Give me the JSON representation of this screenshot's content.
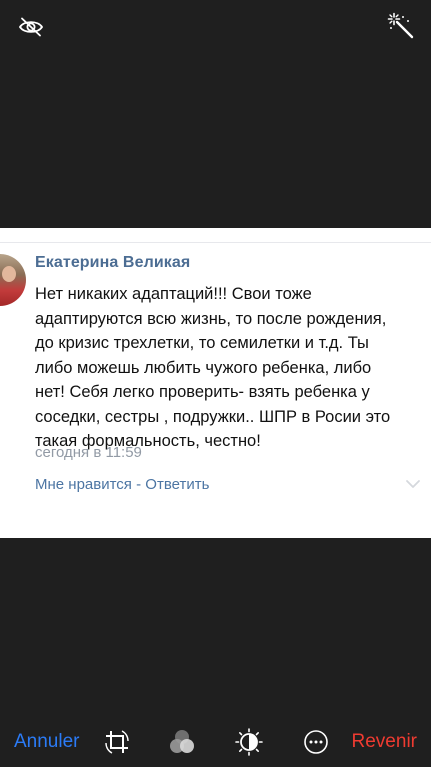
{
  "top_bar": {
    "hide_icon": "eye-slash-icon",
    "auto_enhance_icon": "magic-wand-icon"
  },
  "post": {
    "author": "Екатерина Великая",
    "text": "Нет никаких адаптаций!!! Свои тоже\nадаптируются всю жизнь, то после рождения,\nдо кризис трехлетки, то семилетки и т.д. Ты\nлибо можешь любить чужого ребенка, либо\nнет! Себя легко проверить- взять ребенка у\nсоседки, сестры , подружки.. ШПР в Росии это\nтакая формальность, честно!",
    "time": "сегодня в 11:59",
    "like_label": "Мне нравится",
    "separator": " - ",
    "reply_label": "Ответить",
    "colors": {
      "author": "#4c6d93",
      "link": "#4c75a3",
      "meta": "#929aa5"
    }
  },
  "bottom_bar": {
    "cancel_label": "Annuler",
    "revert_label": "Revenir",
    "tools": [
      "crop-rotate-icon",
      "filters-icon",
      "adjust-light-icon",
      "more-options-icon"
    ],
    "colors": {
      "cancel": "#2b7bf6",
      "revert": "#ef3b31"
    }
  }
}
